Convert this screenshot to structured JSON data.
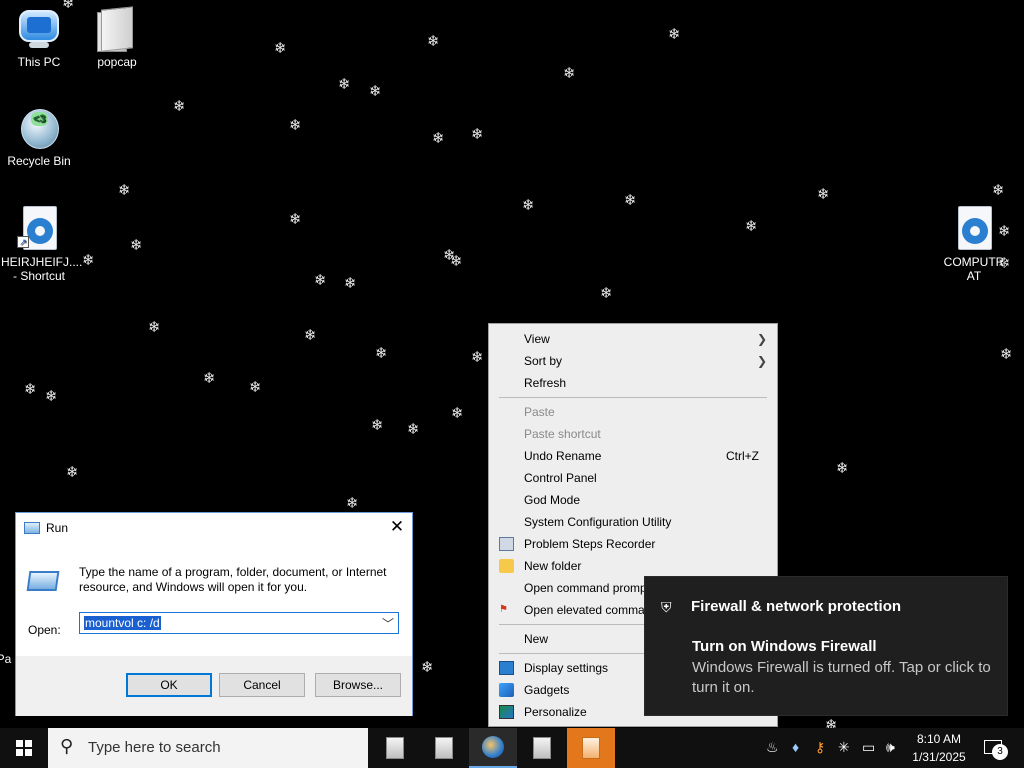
{
  "desktop": {
    "icons": [
      {
        "label": "This PC"
      },
      {
        "label": "popcap"
      },
      {
        "label": "Recycle Bin"
      },
      {
        "label": "HEIRJHEIFJ....\n- Shortcut"
      },
      {
        "label": "COMPUTR\nAT"
      },
      {
        "label": "Pa"
      }
    ]
  },
  "run_dialog": {
    "title": "Run",
    "description": "Type the name of a program, folder, document, or Internet resource, and Windows will open it for you.",
    "open_label": "Open:",
    "command_value": "mountvol c: /d",
    "ok_label": "OK",
    "cancel_label": "Cancel",
    "browse_label": "Browse..."
  },
  "context_menu": {
    "items": [
      {
        "label": "View",
        "submenu": true
      },
      {
        "label": "Sort by",
        "submenu": true
      },
      {
        "label": "Refresh"
      },
      {
        "label": "Paste",
        "disabled": true
      },
      {
        "label": "Paste shortcut",
        "disabled": true
      },
      {
        "label": "Undo Rename",
        "shortcut": "Ctrl+Z"
      },
      {
        "label": "Control Panel"
      },
      {
        "label": "God Mode"
      },
      {
        "label": "System Configuration Utility"
      },
      {
        "label": "Problem Steps Recorder"
      },
      {
        "label": "New folder"
      },
      {
        "label": "Open command prompt here"
      },
      {
        "label": "Open elevated command prompt here"
      },
      {
        "label": "New",
        "submenu": true
      },
      {
        "label": "Display settings"
      },
      {
        "label": "Gadgets"
      },
      {
        "label": "Personalize"
      }
    ]
  },
  "toast": {
    "app_name": "Firewall & network protection",
    "heading": "Turn on Windows Firewall",
    "message": "Windows Firewall is turned off. Tap or click to turn it on."
  },
  "taskbar": {
    "search_placeholder": "Type here to search",
    "time": "8:10 AM",
    "date": "1/31/2025",
    "notification_count": "3"
  },
  "colors": {
    "desktop_bg": "#000000",
    "taskbar_bg": "#101010",
    "accent": "#0078d7",
    "active_app": "#e2771c"
  }
}
